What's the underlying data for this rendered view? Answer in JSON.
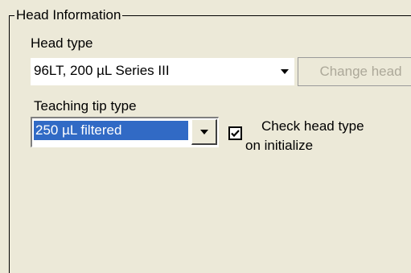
{
  "groupbox": {
    "title": "Head Information"
  },
  "head_type": {
    "label": "Head type",
    "value": "96LT, 200 µL Series III",
    "change_button": "Change head"
  },
  "teaching_tip": {
    "label": "Teaching tip type",
    "value": "250 µL filtered"
  },
  "check_head": {
    "label_line1": "Check head type",
    "label_line2": "on initialize",
    "checked": true
  },
  "icons": {
    "dropdown": "chevron-down-icon",
    "checkmark": "checkmark-icon"
  },
  "colors": {
    "window_bg": "#ece9d8",
    "selection": "#316ac5",
    "disabled_text": "#aca899"
  }
}
